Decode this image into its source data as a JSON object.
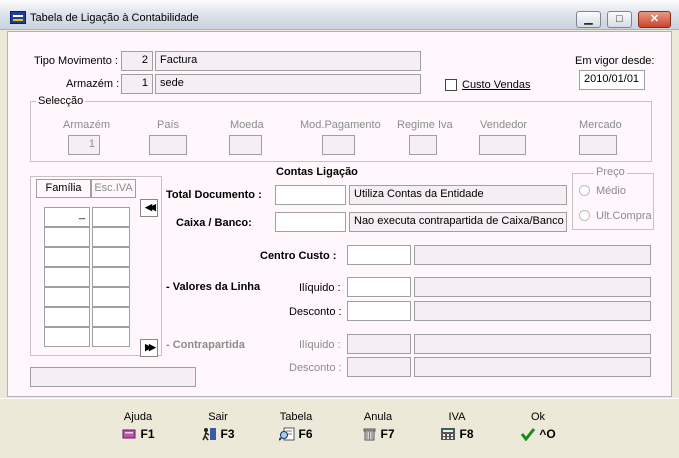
{
  "window": {
    "title": "Tabela de Ligação à Contabilidade",
    "min_glyph": "▁",
    "max_glyph": "□",
    "close_glyph": "✕"
  },
  "header": {
    "tipo_movimento_label": "Tipo Movimento :",
    "tipo_movimento_code": "2",
    "tipo_movimento_name": "Factura",
    "armazem_label": "Armazém :",
    "armazem_code": "1",
    "armazem_name": "sede",
    "custo_vendas_label": "Custo Vendas",
    "vigor_label": "Em vigor desde:",
    "vigor_date": "2010/01/01"
  },
  "seleccao": {
    "title": "Selecção",
    "columns": [
      {
        "label": "Armazém",
        "value": "1"
      },
      {
        "label": "País",
        "value": ""
      },
      {
        "label": "Moeda",
        "value": ""
      },
      {
        "label": "Mod.Pagamento",
        "value": ""
      },
      {
        "label": "Regime Iva",
        "value": ""
      },
      {
        "label": "Vendedor",
        "value": ""
      },
      {
        "label": "Mercado",
        "value": ""
      }
    ]
  },
  "grid": {
    "tabs": [
      "Família",
      "Esc.IVA"
    ],
    "cursor": "_",
    "nav_up": "◀◀",
    "nav_down": "▶▶"
  },
  "contas": {
    "title": "Contas Ligação",
    "total_documento_label": "Total Documento :",
    "total_documento_value": "",
    "total_documento_desc": "Utiliza Contas da Entidade",
    "caixa_banco_label": "Caixa / Banco:",
    "caixa_banco_value": "",
    "caixa_banco_desc": "Nao executa contrapartida de Caixa/Banco",
    "centro_custo_label": "Centro Custo :",
    "valores_linha_label": "- Valores da Linha",
    "liquido_label": "Ilíquido :",
    "desconto_label": "Desconto :",
    "contrapartida_label": "- Contrapartida",
    "cp_liquido_label": "Ilíquido :",
    "cp_desconto_label": "Desconto :"
  },
  "preco": {
    "title": "Preço",
    "options": [
      "Médio",
      "Ult.Compra"
    ]
  },
  "function_keys": [
    {
      "label": "Ajuda",
      "key": "F1",
      "icon": "book-icon"
    },
    {
      "label": "Sair",
      "key": "F3",
      "icon": "exit-door-icon"
    },
    {
      "label": "Tabela",
      "key": "F6",
      "icon": "search-table-icon"
    },
    {
      "label": "Anula",
      "key": "F7",
      "icon": "trash-icon"
    },
    {
      "label": "IVA",
      "key": "F8",
      "icon": "calculator-icon"
    },
    {
      "label": "Ok",
      "key": "^O",
      "icon": "checkmark-icon"
    }
  ],
  "colors": {
    "panel_bg": "#fff7fb",
    "window_bg": "#ece9d8",
    "close_red": "#c9452b",
    "check_green": "#1a8a1a"
  }
}
